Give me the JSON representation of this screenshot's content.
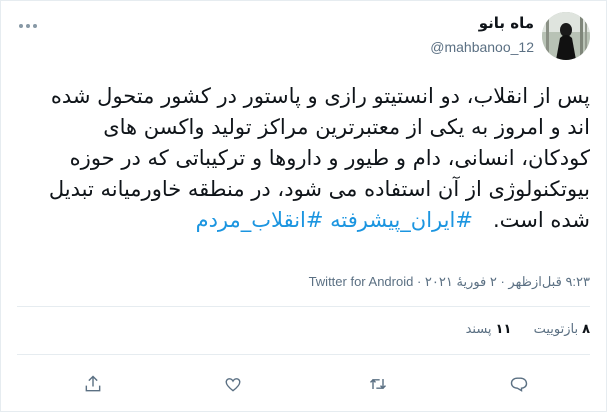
{
  "tweet": {
    "display_name": "ماه بانو",
    "handle": "@mahbanoo_12",
    "text_plain": "پس از انقلاب، دو انستیتو رازی و پاستور در کشور متحول شده اند و امروز به یکی از معتبرترین مراکز تولید واکسن های کودکان، انسانی، دام و طیور و داروها و ترکیباتی که در حوزه بیوتکنولوژی از آن استفاده می شود، در منطقه خاورمیانه تبدیل شده است.",
    "hashtag_1": "#ایران_پیشرفته",
    "hashtag_2": "#انقلاب_مردم",
    "time_date": "۹:۲۳ قبل‌ازظهر · ۲ فوریهٔ ۲۰۲۱ ·",
    "source": "Twitter for Android"
  },
  "stats": {
    "retweets_count": "۸",
    "retweets_label": "بازتوییت",
    "likes_count": "۱۱",
    "likes_label": "پسند"
  },
  "actions": {
    "icons": [
      "reply-icon",
      "retweet-icon",
      "like-icon",
      "share-icon"
    ]
  },
  "colors": {
    "accent": "#1b95e0",
    "secondary_text": "#5b7083",
    "border": "#e6ecf0"
  }
}
